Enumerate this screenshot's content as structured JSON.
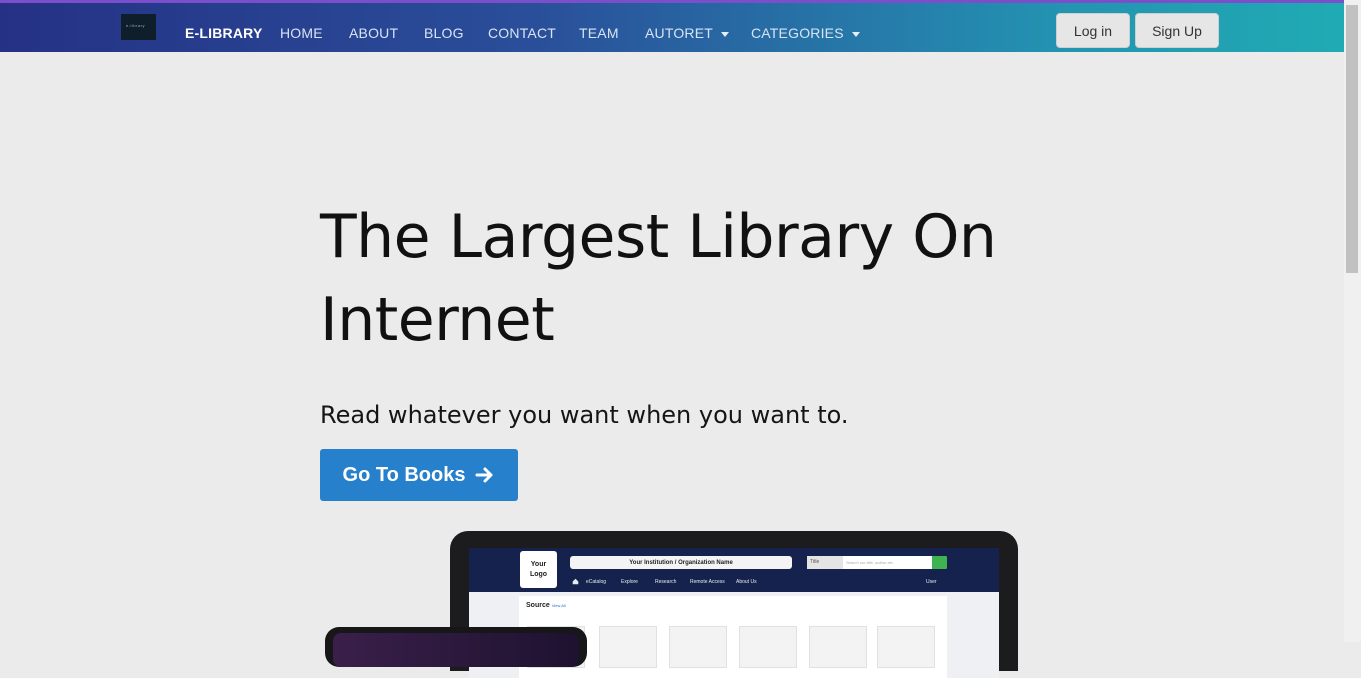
{
  "navbar": {
    "logo_text": "e-library",
    "brand": "E-LIBRARY",
    "items": [
      {
        "label": "HOME"
      },
      {
        "label": "ABOUT"
      },
      {
        "label": "BLOG"
      },
      {
        "label": "CONTACT"
      },
      {
        "label": "TEAM"
      },
      {
        "label": "AUTORET",
        "dropdown": true
      },
      {
        "label": "CATEGORIES",
        "dropdown": true
      }
    ],
    "login_label": "Log in",
    "signup_label": "Sign Up"
  },
  "hero": {
    "title_line1": "The Largest Library On",
    "title_line2": "Internet",
    "subtitle": "Read whatever you want when you want to.",
    "cta_label": "Go To Books"
  },
  "mockup": {
    "logo_line1": "Your",
    "logo_line2": "Logo",
    "institution": "Your Institution / Organization Name",
    "search_select": "Title",
    "search_placeholder": "Search our title, author etc.",
    "menu": [
      "eCatalog",
      "Explore",
      "Research",
      "Remote Access",
      "About Us"
    ],
    "user_menu": "User",
    "source_label": "Source",
    "view_all": "View All"
  },
  "colors": {
    "navbar_start": "#253185",
    "navbar_end": "#20abb3",
    "cta": "#2680cc",
    "page_bg": "#ebebeb"
  },
  "icons": {
    "cta": "arrow-right-icon",
    "dropdown": "caret-down-icon",
    "mockup_home": "home-icon",
    "mockup_search": "search-icon"
  }
}
